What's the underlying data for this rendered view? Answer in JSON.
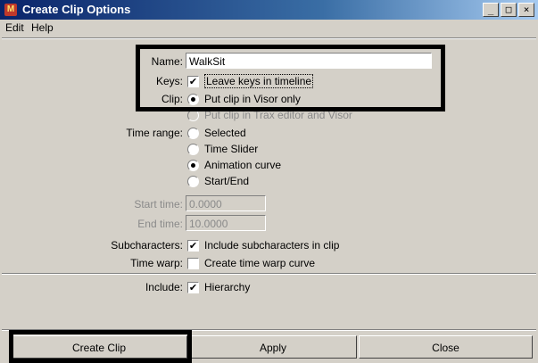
{
  "window": {
    "title": "Create Clip Options",
    "controls": [
      "_",
      "□",
      "×"
    ]
  },
  "menu": [
    "Edit",
    "Help"
  ],
  "form": {
    "name": {
      "label": "Name:",
      "value": "WalkSit"
    },
    "keys": {
      "label": "Keys:",
      "option": "Leave keys in timeline",
      "checked": true
    },
    "clip": {
      "label": "Clip:",
      "options": [
        "Put clip in Visor only",
        "Put clip in Trax editor and Visor"
      ],
      "selected": "Put clip in Visor only"
    },
    "time_range": {
      "label": "Time range:",
      "options": [
        "Selected",
        "Time Slider",
        "Animation curve",
        "Start/End"
      ],
      "selected": "Animation curve"
    },
    "start_time": {
      "label": "Start time:",
      "value": "0.0000"
    },
    "end_time": {
      "label": "End time:",
      "value": "10.0000"
    },
    "subcharacters": {
      "label": "Subcharacters:",
      "option": "Include subcharacters in clip",
      "checked": true
    },
    "time_warp": {
      "label": "Time warp:",
      "option": "Create time warp curve",
      "checked": false
    },
    "include": {
      "label": "Include:",
      "option": "Hierarchy",
      "checked": true
    }
  },
  "buttons": {
    "create": "Create Clip",
    "apply": "Apply",
    "close": "Close"
  },
  "icons": {
    "app": "maya-icon",
    "check": "✔"
  }
}
